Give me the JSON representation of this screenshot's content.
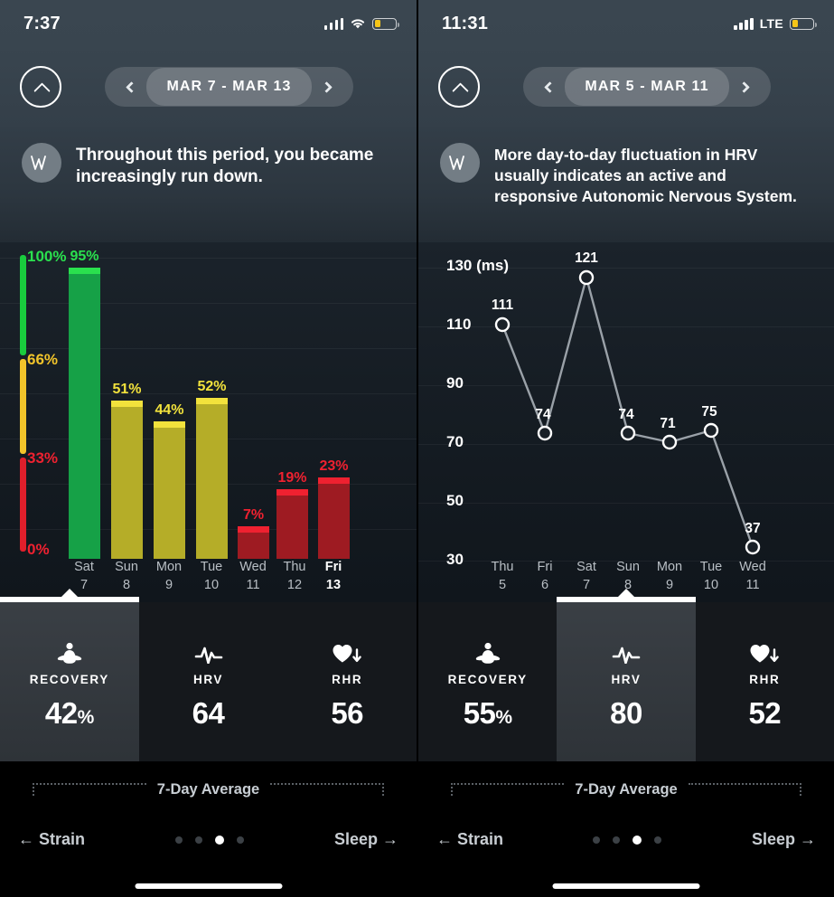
{
  "left": {
    "status": {
      "time": "7:37",
      "connection_icon": "wifi-icon",
      "signal_icon": "cellular-signal-icon",
      "battery_icon": "battery-low-icon",
      "battery_color": "#f5c518"
    },
    "nav": {
      "collapse_icon": "chevron-up-icon",
      "prev_icon": "chevron-left-icon",
      "next_icon": "chevron-right-icon",
      "date_range": "MAR 7 - MAR 13"
    },
    "insight": {
      "avatar_icon": "whoop-logo-icon",
      "avatar_text": "ⅴⅴ",
      "message": "Throughout this period, you became increasingly run down."
    },
    "chart_data": {
      "type": "bar",
      "title": "Recovery",
      "xlabel": "",
      "ylabel": "Recovery %",
      "ylim": [
        0,
        100
      ],
      "unit": "%",
      "grid": true,
      "categories": [
        "Sat 7",
        "Sun 8",
        "Mon 9",
        "Tue 10",
        "Wed 11",
        "Thu 12",
        "Fri 13"
      ],
      "day_names": [
        "Sat",
        "Sun",
        "Mon",
        "Tue",
        "Wed",
        "Thu",
        "Fri"
      ],
      "day_numbers": [
        "7",
        "8",
        "9",
        "10",
        "11",
        "12",
        "13"
      ],
      "values": [
        95,
        51,
        44,
        52,
        7,
        19,
        23
      ],
      "labels": [
        "95%",
        "51%",
        "44%",
        "52%",
        "7%",
        "19%",
        "23%"
      ],
      "today_index": 6,
      "bar_colors": [
        "#16a147",
        "#b5ad28",
        "#b5ad28",
        "#b5ad28",
        "#c0202b",
        "#c0202b",
        "#c0202b"
      ],
      "cap_colors": [
        "#2ae04e",
        "#f2e23c",
        "#f2e23c",
        "#f2e23c",
        "#ef2130",
        "#ef2130",
        "#ef2130"
      ],
      "label_colors": [
        "#2ae04e",
        "#f2e23c",
        "#f2e23c",
        "#f2e23c",
        "#ef2130",
        "#ef2130",
        "#ef2130"
      ],
      "gauge": {
        "ticks": [
          "100%",
          "66%",
          "33%",
          "0%"
        ],
        "tick_values": [
          100,
          66,
          33,
          0
        ],
        "segments": [
          {
            "label": "green-zone",
            "from": 66,
            "to": 100,
            "color": "#19cc3d"
          },
          {
            "label": "yellow-zone",
            "from": 33,
            "to": 66,
            "color": "#f2c42a"
          },
          {
            "label": "red-zone",
            "from": 0,
            "to": 33,
            "color": "#e01f2b"
          }
        ],
        "tick_colors": [
          "#2ae04e",
          "#f2c42a",
          "#ef2130",
          "#ef2130"
        ]
      }
    },
    "metrics": [
      {
        "icon": "meditation-icon",
        "label": "RECOVERY",
        "value": "42",
        "suffix": "%",
        "active": true
      },
      {
        "icon": "hrv-pulse-icon",
        "label": "HRV",
        "value": "64",
        "suffix": "",
        "active": false
      },
      {
        "icon": "heart-down-icon",
        "label": "RHR",
        "value": "56",
        "suffix": "",
        "active": false
      }
    ],
    "average_label": "7-Day Average",
    "footer": {
      "prev_label": "← Strain",
      "next_label": "Sleep →",
      "dot_count": 4,
      "active_dot": 2
    }
  },
  "right": {
    "status": {
      "time": "11:31",
      "connection_icon": "lte-icon",
      "connection_text": "LTE",
      "signal_icon": "cellular-signal-icon",
      "battery_icon": "battery-low-icon",
      "battery_color": "#f5c518"
    },
    "nav": {
      "collapse_icon": "chevron-up-icon",
      "prev_icon": "chevron-left-icon",
      "next_icon": "chevron-right-icon",
      "date_range": "MAR 5 - MAR 11"
    },
    "insight": {
      "avatar_icon": "whoop-logo-icon",
      "avatar_text": "ⅴⅴ",
      "message": "More day-to-day fluctuation in HRV usually indicates an active and responsive Autonomic Nervous System."
    },
    "chart_data": {
      "type": "line",
      "title": "HRV",
      "xlabel": "",
      "ylabel": "130 (ms)",
      "unit": "ms",
      "ylim": [
        30,
        130
      ],
      "grid": true,
      "yticks": [
        130,
        110,
        90,
        70,
        50,
        30
      ],
      "ytick_labels": [
        "130 (ms)",
        "110",
        "90",
        "70",
        "50",
        "30"
      ],
      "categories": [
        "Thu 5",
        "Fri 6",
        "Sat 7",
        "Sun 8",
        "Mon 9",
        "Tue 10",
        "Wed 11"
      ],
      "day_names": [
        "Thu",
        "Fri",
        "Sat",
        "Sun",
        "Mon",
        "Tue",
        "Wed"
      ],
      "day_numbers": [
        "5",
        "6",
        "7",
        "8",
        "9",
        "10",
        "11"
      ],
      "values": [
        111,
        74,
        121,
        74,
        71,
        75,
        37
      ],
      "labels": [
        "111",
        "74",
        "121",
        "74",
        "71",
        "75",
        "37"
      ],
      "line_color": "#9aa1a8",
      "marker_color": "#ffffff",
      "marker_fill": "#1a2128"
    },
    "metrics": [
      {
        "icon": "meditation-icon",
        "label": "RECOVERY",
        "value": "55",
        "suffix": "%",
        "active": false
      },
      {
        "icon": "hrv-pulse-icon",
        "label": "HRV",
        "value": "80",
        "suffix": "",
        "active": true
      },
      {
        "icon": "heart-down-icon",
        "label": "RHR",
        "value": "52",
        "suffix": "",
        "active": false
      }
    ],
    "average_label": "7-Day Average",
    "footer": {
      "prev_label": "← Strain",
      "next_label": "Sleep →",
      "dot_count": 4,
      "active_dot": 2
    }
  }
}
